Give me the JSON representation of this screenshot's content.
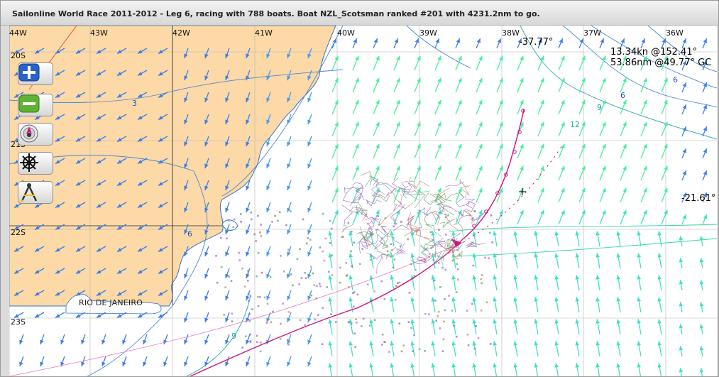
{
  "window": {
    "title": "Sailonline World Race 2011-2012 - Leg 6, racing with 788 boats. Boat NZL_Scotsman ranked #201 with 4231.2nm to go."
  },
  "map": {
    "longitude_labels": [
      "44W",
      "43W",
      "42W",
      "41W",
      "40W",
      "39W",
      "38W",
      "37W",
      "36W"
    ],
    "latitude_labels": [
      "20S",
      "21S",
      "22S",
      "23S"
    ],
    "cursor_longitude": "-37.77°",
    "cursor_latitude": "-21.61°",
    "speed_readout": "13.34kn @152.41°",
    "distance_readout": "53.86nm @49.77° GC",
    "place_label": "RIO DE JANEIRO",
    "isobar_labels": [
      "3",
      "6",
      "6",
      "6",
      "9",
      "9",
      "12"
    ],
    "colors": {
      "land": "#fcd9a6",
      "coast": "#2e74c9",
      "isobar": "#4a88d4",
      "wind_light": "#3b80e8",
      "wind_strong": "#46ef9d",
      "own_track": "#d1147f",
      "fleet": "#9c64a8"
    }
  },
  "toolbar": {
    "zoom_in_icon": "plus-icon",
    "zoom_out_icon": "minus-icon",
    "center_boat_icon": "compass-arrow-icon",
    "helm_icon": "helm-wheel-icon",
    "measure_icon": "divider-compass-icon"
  }
}
